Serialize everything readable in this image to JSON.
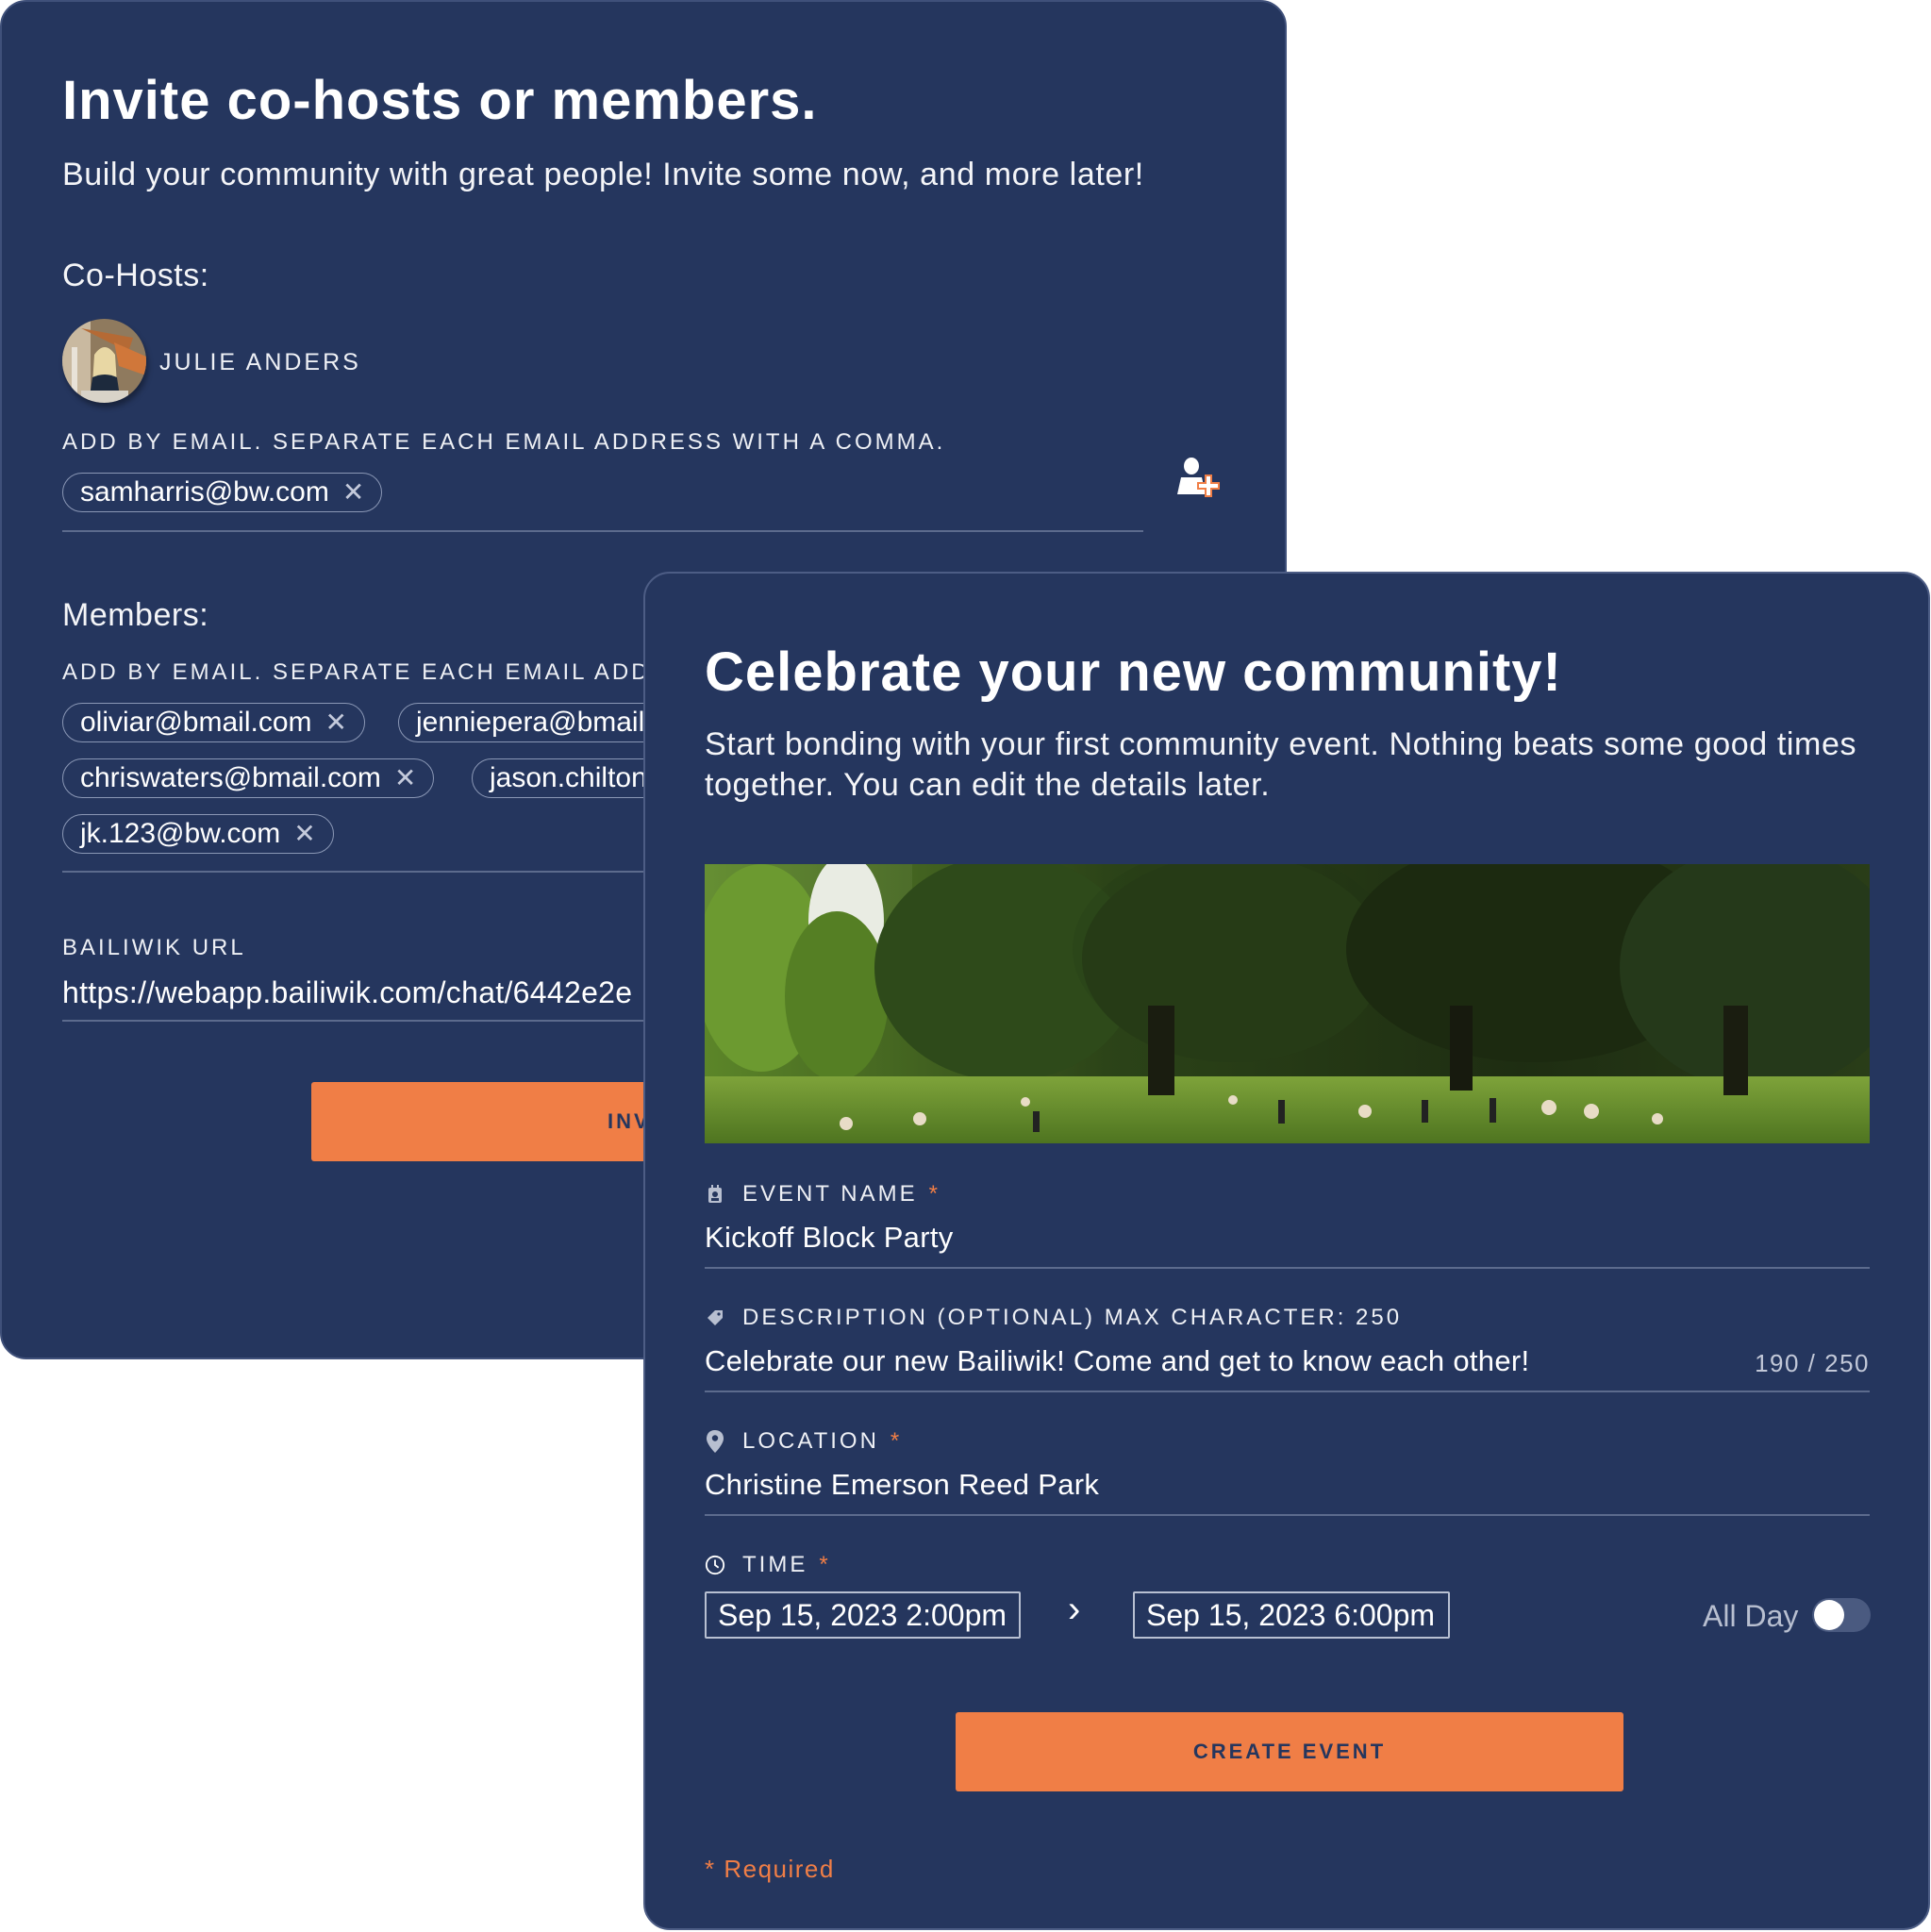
{
  "invite_card": {
    "title": "Invite co-hosts or members.",
    "subtitle": "Build your community with great people! Invite some now, and more later!",
    "cohosts": {
      "label": "Co-Hosts:",
      "people": [
        {
          "name": "JULIE ANDERS",
          "avatar": "profile-photo"
        }
      ],
      "email_hint": "ADD BY EMAIL. SEPARATE EACH EMAIL ADDRESS WITH A COMMA.",
      "chips": [
        "samharris@bw.com"
      ],
      "add_icon": "add-person-icon"
    },
    "members": {
      "label": "Members:",
      "email_hint": "ADD BY EMAIL. SEPARATE EACH EMAIL ADDRESS WITH A COMMA.",
      "chips": [
        "oliviar@bmail.com",
        "jenniepera@bmail.com",
        "chriswaters@bmail.com",
        "jason.chilton@bmail.com",
        "jk.123@bw.com"
      ]
    },
    "url": {
      "label": "BAILIWIK URL",
      "value": "https://webapp.bailiwik.com/chat/6442e2e"
    },
    "invite_button": "INVITE",
    "remove_glyph": "✕"
  },
  "event_card": {
    "title": "Celebrate your new community!",
    "subtitle": "Start bonding with your first community event. Nothing beats some good times together. You can edit the details later.",
    "image": "park-with-trees-and-people",
    "fields": {
      "event_name": {
        "icon": "calendar-badge-icon",
        "label": "EVENT NAME",
        "required": "*",
        "value": "Kickoff Block Party"
      },
      "description": {
        "icon": "tag-icon",
        "label": "DESCRIPTION (OPTIONAL) MAX CHARACTER: 250",
        "value": "Celebrate our new Bailiwik! Come and get to know each other!",
        "counter": "190 / 250"
      },
      "location": {
        "icon": "map-pin-icon",
        "label": "LOCATION",
        "required": "*",
        "value": "Christine Emerson Reed Park"
      },
      "time": {
        "icon": "clock-icon",
        "label": "TIME",
        "required": "*",
        "start": "Sep 15, 2023  2:00pm",
        "separator": "›",
        "end": "Sep 15, 2023  6:00pm",
        "all_day_label": "All Day",
        "all_day": false
      }
    },
    "create_button": "CREATE EVENT",
    "required_note": "* Required"
  },
  "colors": {
    "card_bg": "#25365e",
    "accent": "#f07e46"
  }
}
